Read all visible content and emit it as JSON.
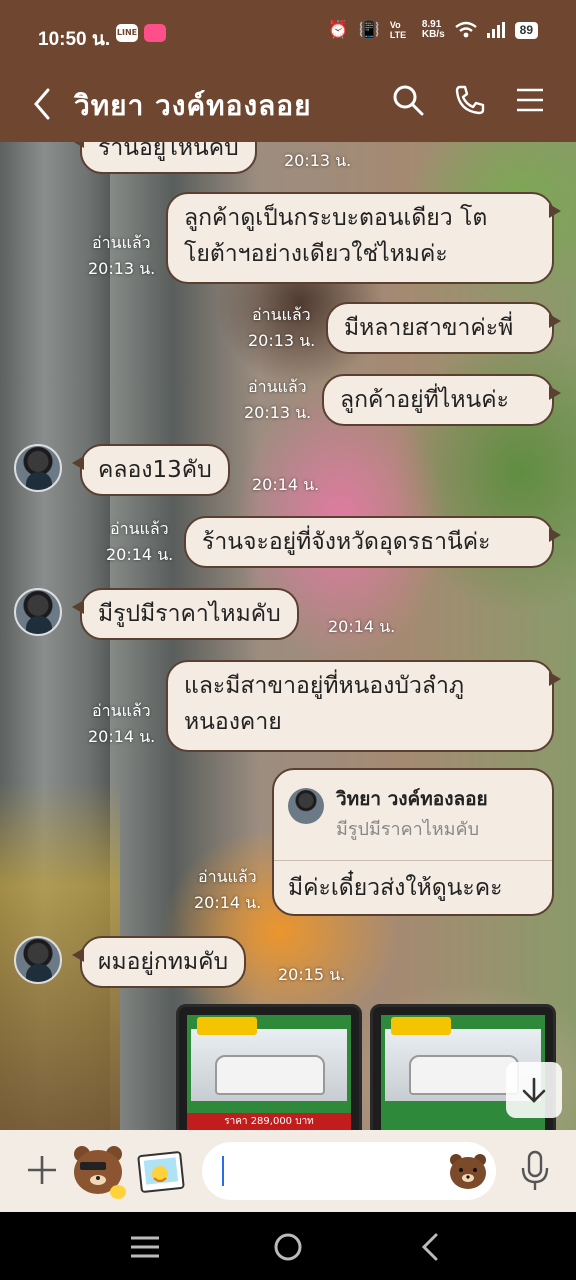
{
  "status_bar": {
    "time": "10:50 น.",
    "line_badge": "LINE",
    "network": "Vo LTE",
    "speed_value": "8.91",
    "speed_unit": "KB/s",
    "battery": "89"
  },
  "header": {
    "title": "วิทยา  วงค์ทองลอย"
  },
  "messages": {
    "m0": {
      "text": "ร้านอยู่ไหนคับ",
      "time": "20:13 น."
    },
    "m1": {
      "line1": "ลูกค้าดูเป็นกระบะตอนเดียว โต",
      "line2": "โยต้าฯอย่างเดียวใช่ไหมค่ะ",
      "read": "อ่านแล้ว",
      "time": "20:13 น."
    },
    "m2": {
      "text": "มีหลายสาขาค่ะพี่",
      "read": "อ่านแล้ว",
      "time": "20:13 น."
    },
    "m3": {
      "text": "ลูกค้าอยู่ที่ไหนค่ะ",
      "read": "อ่านแล้ว",
      "time": "20:13 น."
    },
    "m4": {
      "text": "คลอง13คับ",
      "time": "20:14 น."
    },
    "m5": {
      "text": "ร้านจะอยู่ที่จังหวัดอุดรธานีค่ะ",
      "read": "อ่านแล้ว",
      "time": "20:14 น."
    },
    "m6": {
      "text": "มีรูปมีราคาไหมคับ",
      "time": "20:14 น."
    },
    "m7": {
      "line1": "และมีสาขาอยู่ที่หนองบัวลำภู",
      "line2": "หนองคาย",
      "read": "อ่านแล้ว",
      "time": "20:14 น."
    },
    "m8": {
      "reply_name": "วิทยา  วงค์ทองลอย",
      "reply_quote": "มีรูปมีราคาไหมคับ",
      "text": "มีค่ะเดี๋ยวส่งให้ดูนะคะ",
      "read": "อ่านแล้ว",
      "time": "20:14 น."
    },
    "m9": {
      "text": "ผมอยู่กทมคับ",
      "time": "20:15 น."
    }
  },
  "photos": [
    {
      "price": "ราคา 289,000 บาท"
    },
    {
      "price": ""
    }
  ],
  "colors": {
    "header_bg": "#6f4630",
    "bubble_bg": "#f4ece3",
    "bubble_border": "#5a4030",
    "input_bar_bg": "#f3ece4"
  },
  "icons": {
    "header": [
      "back-icon",
      "search-icon",
      "phone-icon",
      "menu-icon"
    ],
    "input_bar": [
      "plus-icon",
      "sticker-brown-icon",
      "sticker-photo-icon",
      "emoji-icon",
      "mic-icon"
    ],
    "nav": [
      "recent-apps-icon",
      "home-icon",
      "nav-back-icon"
    ]
  }
}
